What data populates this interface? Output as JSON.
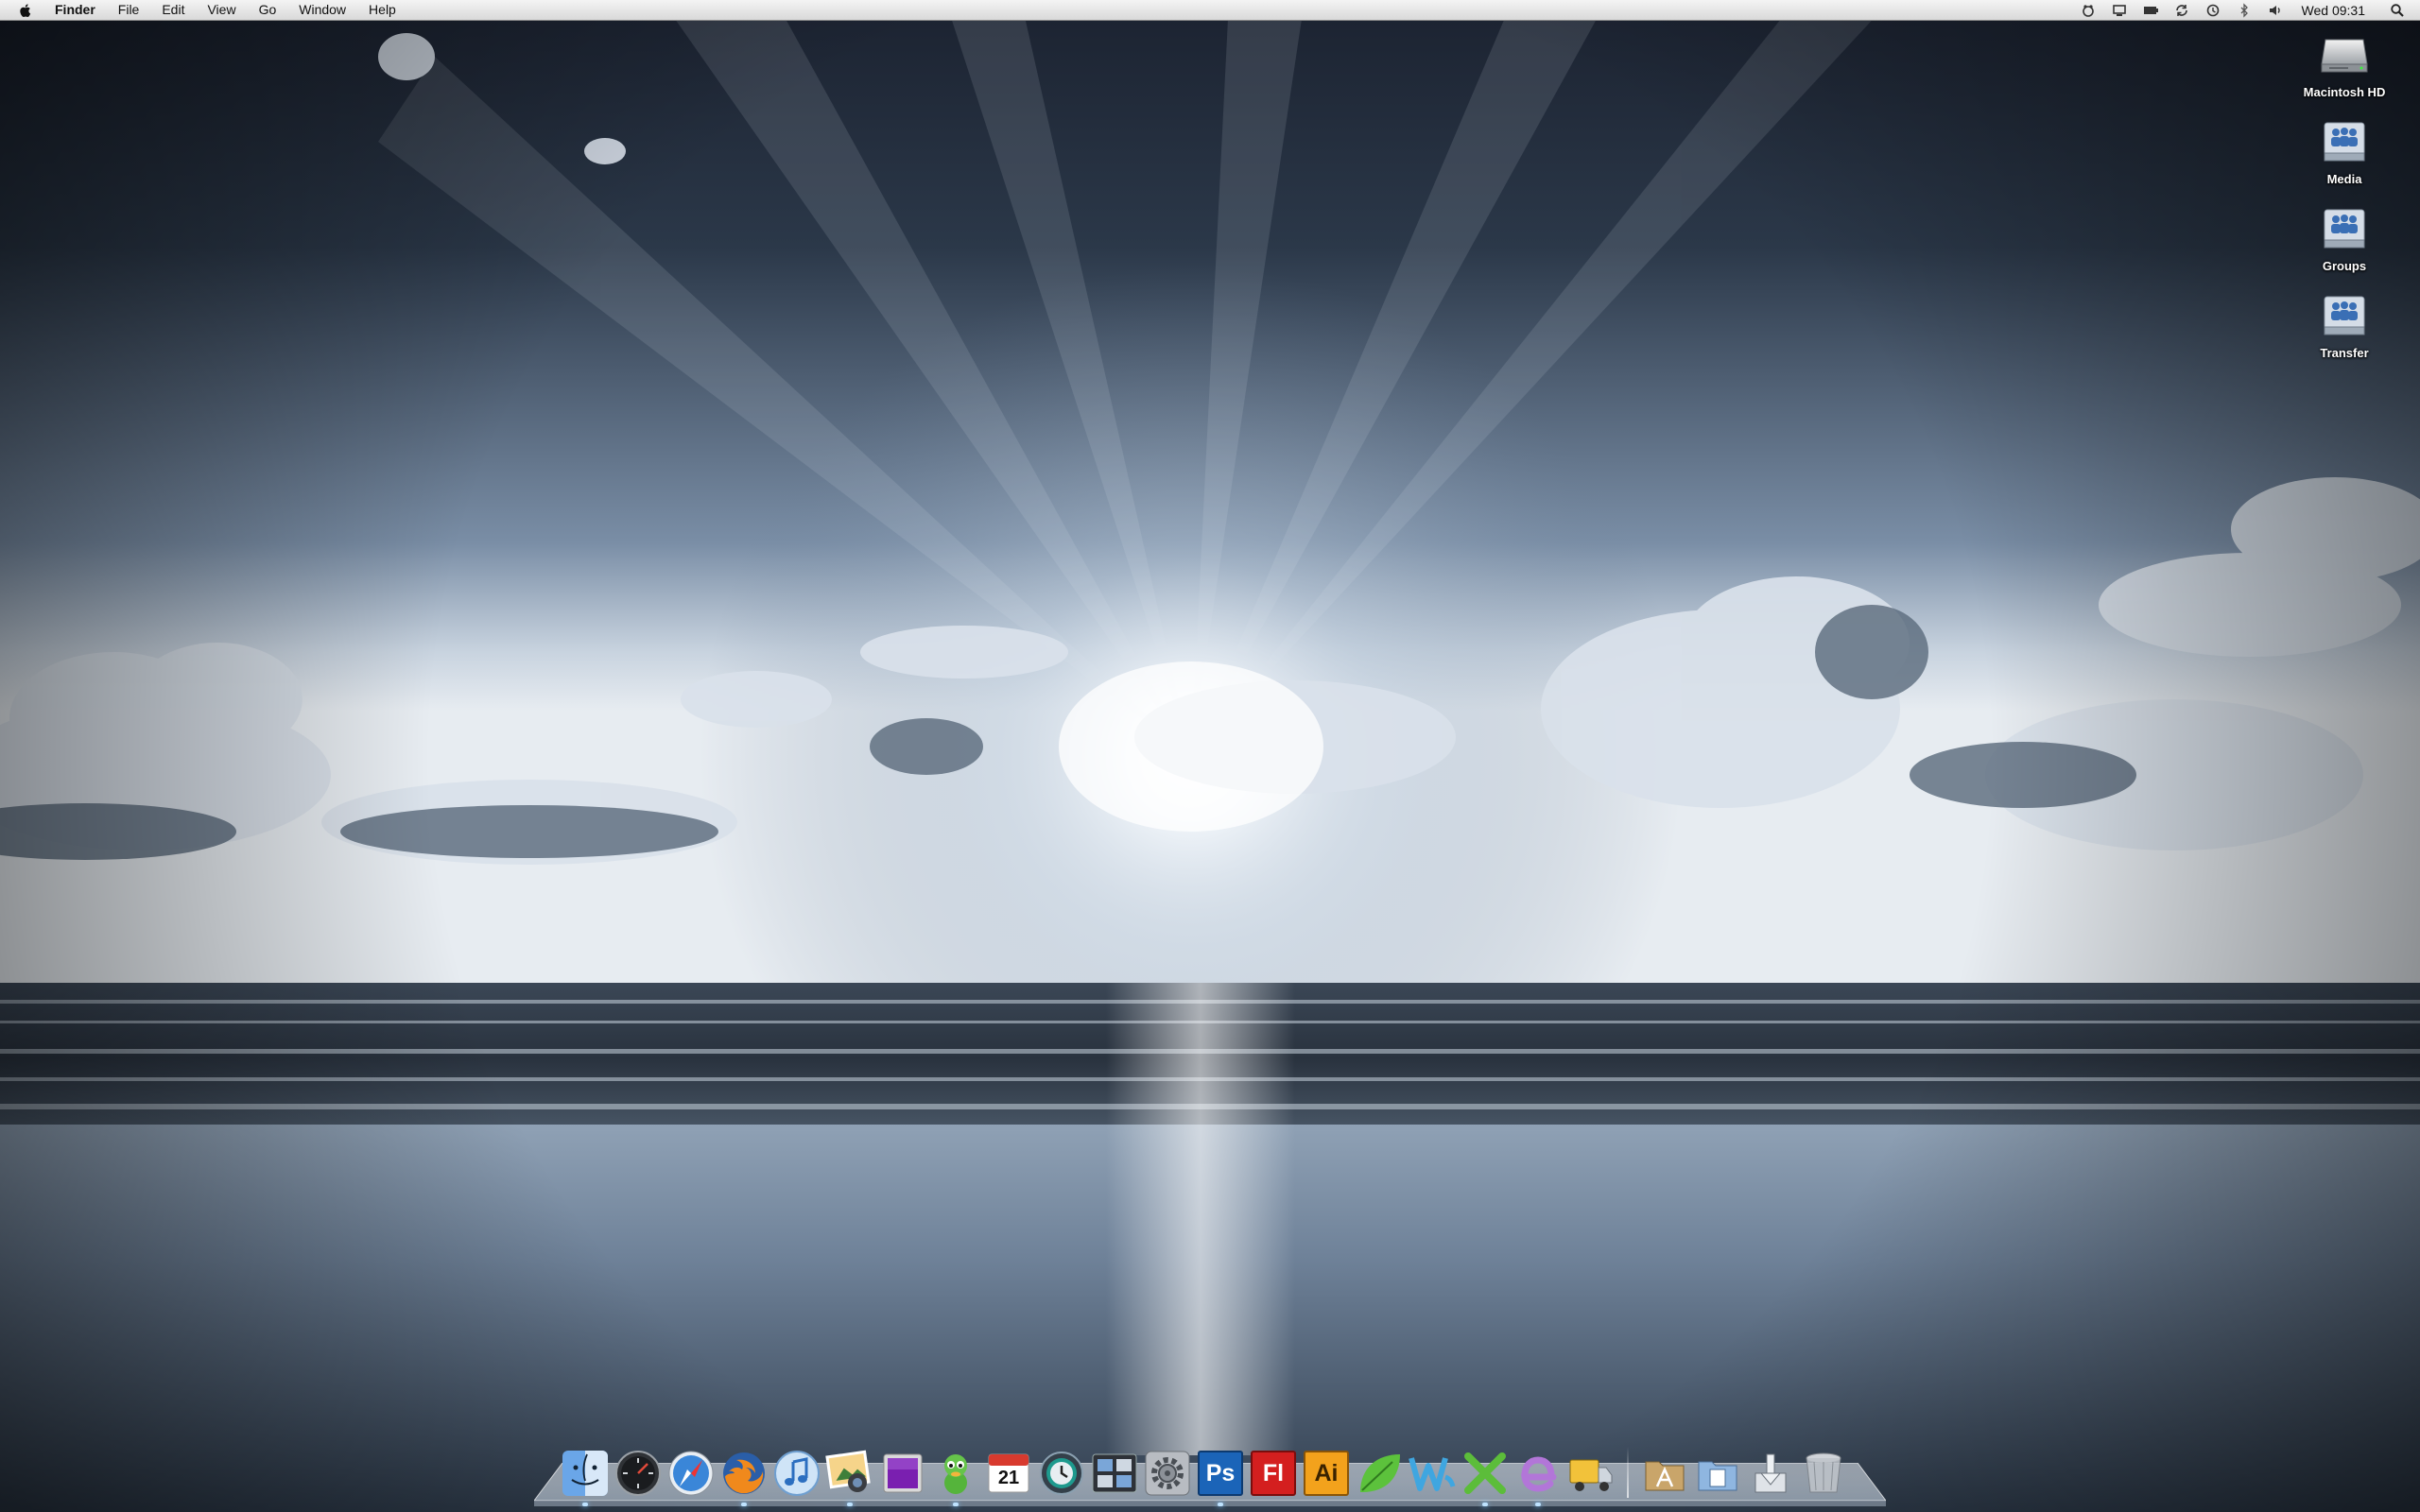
{
  "menubar": {
    "apple_icon": "apple-logo",
    "menus": [
      "Finder",
      "File",
      "Edit",
      "View",
      "Go",
      "Window",
      "Help"
    ],
    "status_icons": [
      "growl-icon",
      "display-icon",
      "battery-icon",
      "sync-icon",
      "time-machine-icon",
      "bluetooth-icon",
      "volume-icon"
    ],
    "clock": "Wed 09:31",
    "spotlight_icon": "spotlight-search-icon"
  },
  "desktop": {
    "icons": [
      {
        "label": "Macintosh HD",
        "icon": "hard-drive-icon"
      },
      {
        "label": "Media",
        "icon": "network-share-icon"
      },
      {
        "label": "Groups",
        "icon": "network-share-icon"
      },
      {
        "label": "Transfer",
        "icon": "network-share-icon"
      }
    ]
  },
  "dock": {
    "apps": [
      {
        "name": "finder",
        "icon": "finder-icon",
        "running": true
      },
      {
        "name": "dashboard",
        "icon": "dashboard-icon",
        "running": false
      },
      {
        "name": "safari",
        "icon": "safari-icon",
        "running": false
      },
      {
        "name": "firefox",
        "icon": "firefox-icon",
        "running": true
      },
      {
        "name": "itunes",
        "icon": "itunes-icon",
        "running": false
      },
      {
        "name": "iphoto",
        "icon": "iphoto-icon",
        "running": true
      },
      {
        "name": "purple-app",
        "icon": "purple-square-icon",
        "running": false
      },
      {
        "name": "adium",
        "icon": "adium-icon",
        "running": true
      },
      {
        "name": "ical",
        "icon": "ical-icon",
        "running": false,
        "text": "21"
      },
      {
        "name": "time-machine",
        "icon": "time-machine-icon",
        "running": false
      },
      {
        "name": "expose",
        "icon": "expose-icon",
        "running": false
      },
      {
        "name": "system-preferences",
        "icon": "gear-icon",
        "running": false
      },
      {
        "name": "photoshop",
        "icon": "photoshop-icon",
        "running": true,
        "text": "Ps"
      },
      {
        "name": "flash",
        "icon": "flash-icon",
        "running": false,
        "text": "Fl"
      },
      {
        "name": "illustrator",
        "icon": "illustrator-icon",
        "running": false,
        "text": "Ai"
      },
      {
        "name": "leaf-app",
        "icon": "leaf-icon",
        "running": false
      },
      {
        "name": "word",
        "icon": "word-icon",
        "running": false
      },
      {
        "name": "excel",
        "icon": "excel-icon",
        "running": true
      },
      {
        "name": "entourage",
        "icon": "entourage-icon",
        "running": true
      },
      {
        "name": "transmit",
        "icon": "transmit-truck-icon",
        "running": false
      }
    ],
    "stacks": [
      {
        "name": "applications-stack",
        "icon": "applications-folder-icon"
      },
      {
        "name": "documents-stack",
        "icon": "documents-folder-icon"
      },
      {
        "name": "downloads-stack",
        "icon": "downloads-icon"
      },
      {
        "name": "trash",
        "icon": "trash-icon"
      }
    ]
  },
  "colors": {
    "menubar_bg": "#e6e6e6",
    "ps_blue": "#1b64b8",
    "fl_red": "#d41f1f",
    "ai_orange": "#f3a21c"
  }
}
